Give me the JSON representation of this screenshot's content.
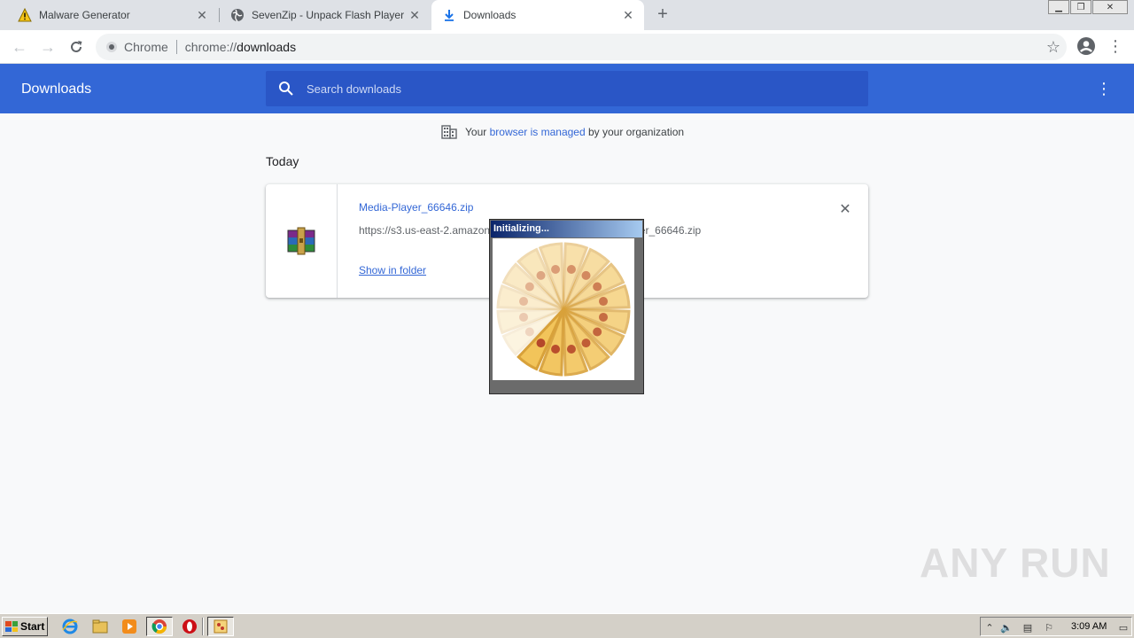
{
  "tabs": [
    {
      "title": "Malware Generator",
      "icon": "warning-icon"
    },
    {
      "title": "SevenZip - Unpack Flash Player",
      "icon": "globe-icon"
    },
    {
      "title": "Downloads",
      "icon": "download-icon",
      "active": true
    }
  ],
  "toolbar": {
    "site_label": "Chrome",
    "url_scheme": "chrome://",
    "url_host": "downloads"
  },
  "downloads_page": {
    "title": "Downloads",
    "search_placeholder": "Search downloads",
    "managed_prefix": "Your",
    "managed_link": "browser is managed",
    "managed_suffix": "by your organization",
    "section_label": "Today"
  },
  "download_item": {
    "file_name": "Media-Player_66646.zip",
    "url": "https://s3.us-east-2.amazonaws.com/ykfzo103g/Media-Player_66646.zip",
    "show_in_folder": "Show in folder",
    "icon": "winrar-archive-icon"
  },
  "popup": {
    "title": "Initializing..."
  },
  "watermark": "ANY RUN",
  "taskbar": {
    "start_label": "Start",
    "clock": "3:09 AM"
  },
  "colors": {
    "header_blue": "#3367d6",
    "search_blue": "#2a56c6",
    "link_blue": "#3367d6"
  }
}
